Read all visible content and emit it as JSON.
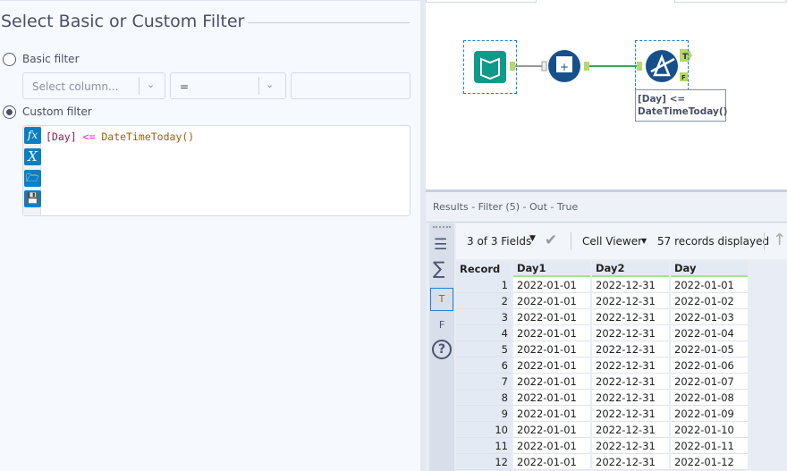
{
  "config": {
    "title": "Select Basic or Custom Filter",
    "basic_label": "Basic filter",
    "column_placeholder": "Select column...",
    "operator": "=",
    "value": "",
    "custom_label": "Custom filter",
    "expression": {
      "field": "[Day]",
      "operator": "<=",
      "function": "DateTimeToday()"
    },
    "selected_mode": "custom"
  },
  "canvas": {
    "annotation_line1": "[Day] <=",
    "annotation_line2": "DateTimeToday()",
    "true_anchor": "T",
    "false_anchor": "F"
  },
  "results": {
    "header": "Results - Filter (5) - Out - True",
    "fields": "3 of 3 Fields",
    "viewer": "Cell Viewer",
    "records": "57 records displayed",
    "sidebar": {
      "true_tab": "T",
      "false_tab": "F"
    },
    "columns": [
      "Record",
      "Day1",
      "Day2",
      "Day"
    ],
    "rows": [
      [
        "1",
        "2022-01-01",
        "2022-12-31",
        "2022-01-01"
      ],
      [
        "2",
        "2022-01-01",
        "2022-12-31",
        "2022-01-02"
      ],
      [
        "3",
        "2022-01-01",
        "2022-12-31",
        "2022-01-03"
      ],
      [
        "4",
        "2022-01-01",
        "2022-12-31",
        "2022-01-04"
      ],
      [
        "5",
        "2022-01-01",
        "2022-12-31",
        "2022-01-05"
      ],
      [
        "6",
        "2022-01-01",
        "2022-12-31",
        "2022-01-06"
      ],
      [
        "7",
        "2022-01-01",
        "2022-12-31",
        "2022-01-07"
      ],
      [
        "8",
        "2022-01-01",
        "2022-12-31",
        "2022-01-08"
      ],
      [
        "9",
        "2022-01-01",
        "2022-12-31",
        "2022-01-09"
      ],
      [
        "10",
        "2022-01-01",
        "2022-12-31",
        "2022-01-10"
      ],
      [
        "11",
        "2022-01-01",
        "2022-12-31",
        "2022-01-11"
      ],
      [
        "12",
        "2022-01-01",
        "2022-12-31",
        "2022-01-12"
      ]
    ]
  },
  "colors": {
    "accent": "#0a7fc2",
    "tool_blue": "#16508a",
    "input_teal": "#0f9a8a",
    "anchor_green": "#b5d86a",
    "connection": "#3aa655"
  }
}
